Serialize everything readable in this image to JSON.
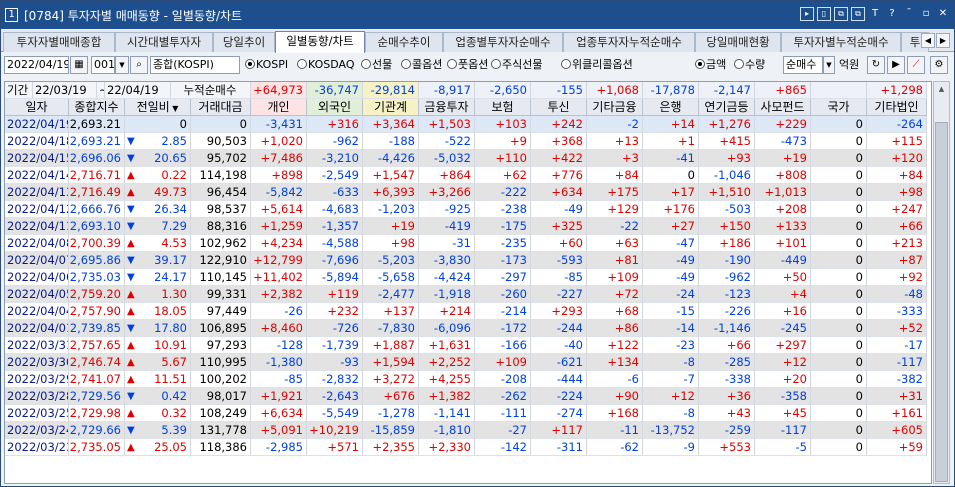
{
  "window": {
    "number": "1",
    "title": "[0784] 투자자별 매매동향 - 일별동향/차트"
  },
  "title_controls": [
    "▸",
    "▯",
    "⧉",
    "⧉",
    "T",
    "?",
    "ˉ",
    "▫",
    "✕"
  ],
  "tabs": [
    "투자자별매매종합",
    "시간대별투자자",
    "당일추이",
    "일별동향/차트",
    "순매수추이",
    "업종별투자자순매수",
    "업종투자자누적순매수",
    "당일매매현황",
    "투자자별누적순매수",
    "투"
  ],
  "active_tab": 3,
  "toolbar": {
    "date": "2022/04/19",
    "code": "001",
    "search_icon": "search-icon",
    "market": "종합(KOSPI)",
    "radios": [
      "KOSPI",
      "KOSDAQ",
      "선물",
      "콜옵션",
      "풋옵션",
      "주식선물",
      "위클리콜옵션"
    ],
    "radio_selected": 0,
    "unit_radios": [
      "금액",
      "수량"
    ],
    "unit_selected": 0,
    "mode": "순매수",
    "unit_label": "억원"
  },
  "summary": {
    "label": "기간",
    "from": "22/03/19",
    "sep": "~",
    "to": "22/04/19",
    "cum_label": "누적순매수",
    "values": [
      "+64,973",
      "-36,747",
      "-29,814",
      "-8,917",
      "-2,650",
      "-155",
      "+1,068",
      "-17,878",
      "-2,147",
      "+865",
      "",
      "+1,298"
    ]
  },
  "columns": [
    "일자",
    "종합지수",
    "전일비",
    "거래대금",
    "개인",
    "외국인",
    "기관계",
    "금융투자",
    "보험",
    "투신",
    "기타금융",
    "은행",
    "연기금등",
    "사모펀드",
    "국가",
    "기타법인"
  ],
  "rows": [
    [
      "2022/04/19",
      "2,693.21",
      "",
      "0",
      "0",
      "-3,431",
      "+316",
      "+3,364",
      "+1,503",
      "+103",
      "+242",
      "-2",
      "+14",
      "+1,276",
      "+229",
      "0",
      "-264"
    ],
    [
      "2022/04/18",
      "2,693.21",
      "down",
      "2.85",
      "90,503",
      "+1,020",
      "-962",
      "-188",
      "-522",
      "+9",
      "+368",
      "+13",
      "+1",
      "+415",
      "-473",
      "0",
      "+115"
    ],
    [
      "2022/04/15",
      "2,696.06",
      "down",
      "20.65",
      "95,702",
      "+7,486",
      "-3,210",
      "-4,426",
      "-5,032",
      "+110",
      "+422",
      "+3",
      "-41",
      "+93",
      "+19",
      "0",
      "+120"
    ],
    [
      "2022/04/14",
      "2,716.71",
      "up",
      "0.22",
      "114,198",
      "+898",
      "-2,549",
      "+1,547",
      "+864",
      "+62",
      "+776",
      "+84",
      "0",
      "-1,046",
      "+808",
      "0",
      "+84"
    ],
    [
      "2022/04/13",
      "2,716.49",
      "up",
      "49.73",
      "96,454",
      "-5,842",
      "-633",
      "+6,393",
      "+3,266",
      "-222",
      "+634",
      "+175",
      "+17",
      "+1,510",
      "+1,013",
      "0",
      "+98"
    ],
    [
      "2022/04/12",
      "2,666.76",
      "down",
      "26.34",
      "98,537",
      "+5,614",
      "-4,683",
      "-1,203",
      "-925",
      "-238",
      "-49",
      "+129",
      "+176",
      "-503",
      "+208",
      "0",
      "+247"
    ],
    [
      "2022/04/11",
      "2,693.10",
      "down",
      "7.29",
      "88,316",
      "+1,259",
      "-1,357",
      "+19",
      "-419",
      "-175",
      "+325",
      "-22",
      "+27",
      "+150",
      "+133",
      "0",
      "+66"
    ],
    [
      "2022/04/08",
      "2,700.39",
      "up",
      "4.53",
      "102,962",
      "+4,234",
      "-4,588",
      "+98",
      "-31",
      "-235",
      "+60",
      "+63",
      "-47",
      "+186",
      "+101",
      "0",
      "+213"
    ],
    [
      "2022/04/07",
      "2,695.86",
      "down",
      "39.17",
      "122,910",
      "+12,799",
      "-7,696",
      "-5,203",
      "-3,830",
      "-173",
      "-593",
      "+81",
      "-49",
      "-190",
      "-449",
      "0",
      "+87"
    ],
    [
      "2022/04/06",
      "2,735.03",
      "down",
      "24.17",
      "110,145",
      "+11,402",
      "-5,894",
      "-5,658",
      "-4,424",
      "-297",
      "-85",
      "+109",
      "-49",
      "-962",
      "+50",
      "0",
      "+92"
    ],
    [
      "2022/04/05",
      "2,759.20",
      "up",
      "1.30",
      "99,331",
      "+2,382",
      "+119",
      "-2,477",
      "-1,918",
      "-260",
      "-227",
      "+72",
      "-24",
      "-123",
      "+4",
      "0",
      "-48"
    ],
    [
      "2022/04/04",
      "2,757.90",
      "up",
      "18.05",
      "97,449",
      "-26",
      "+232",
      "+137",
      "+214",
      "-214",
      "+293",
      "+68",
      "-15",
      "-226",
      "+16",
      "0",
      "-333"
    ],
    [
      "2022/04/01",
      "2,739.85",
      "down",
      "17.80",
      "106,895",
      "+8,460",
      "-726",
      "-7,830",
      "-6,096",
      "-172",
      "-244",
      "+86",
      "-14",
      "-1,146",
      "-245",
      "0",
      "+52"
    ],
    [
      "2022/03/31",
      "2,757.65",
      "up",
      "10.91",
      "97,293",
      "-128",
      "-1,739",
      "+1,887",
      "+1,631",
      "-166",
      "-40",
      "+122",
      "-23",
      "+66",
      "+297",
      "0",
      "-17"
    ],
    [
      "2022/03/30",
      "2,746.74",
      "up",
      "5.67",
      "110,995",
      "-1,380",
      "-93",
      "+1,594",
      "+2,252",
      "+109",
      "-621",
      "+134",
      "-8",
      "-285",
      "+12",
      "0",
      "-117"
    ],
    [
      "2022/03/29",
      "2,741.07",
      "up",
      "11.51",
      "100,202",
      "-85",
      "-2,832",
      "+3,272",
      "+4,255",
      "-208",
      "-444",
      "-6",
      "-7",
      "-338",
      "+20",
      "0",
      "-382"
    ],
    [
      "2022/03/28",
      "2,729.56",
      "down",
      "0.42",
      "98,017",
      "+1,921",
      "-2,643",
      "+676",
      "+1,382",
      "-262",
      "-224",
      "+90",
      "+12",
      "+36",
      "-358",
      "0",
      "+31"
    ],
    [
      "2022/03/25",
      "2,729.98",
      "up",
      "0.32",
      "108,249",
      "+6,634",
      "-5,549",
      "-1,278",
      "-1,141",
      "-111",
      "-274",
      "+168",
      "-8",
      "+43",
      "+45",
      "0",
      "+161"
    ],
    [
      "2022/03/24",
      "2,729.66",
      "down",
      "5.39",
      "131,778",
      "+5,091",
      "+10,219",
      "-15,859",
      "-1,810",
      "-27",
      "+117",
      "-11",
      "-13,752",
      "-259",
      "-117",
      "0",
      "+605"
    ],
    [
      "2022/03/23",
      "2,735.05",
      "up",
      "25.05",
      "118,386",
      "-2,985",
      "+571",
      "+2,355",
      "+2,330",
      "-142",
      "-311",
      "-62",
      "-9",
      "+553",
      "-5",
      "0",
      "+59"
    ]
  ],
  "colors": {
    "title_bg": "#1d4f8f",
    "red": "#e00000",
    "blue": "#0040e0",
    "row_highlight": "#dde8f6",
    "row_alt": "#e3e3e3"
  }
}
